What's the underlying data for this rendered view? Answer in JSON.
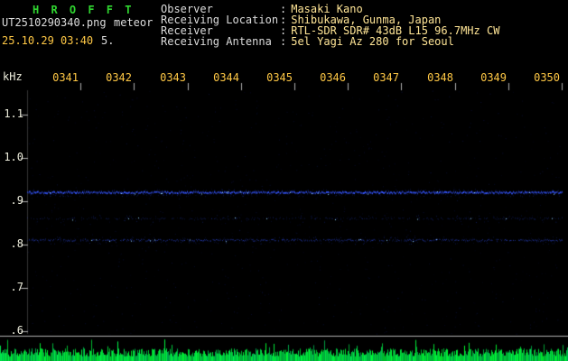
{
  "colors": {
    "title_green": "#30d530",
    "label_white": "#dcdcdc",
    "value_yellow": "#ffe596",
    "time_yellow": "#ffc845",
    "freq_label": "#eeeedd",
    "axis_gray": "#b0b0b0",
    "band_blue": "#3555ff",
    "speckle_cyan": "#9adcff",
    "noise_green": "#00d24b"
  },
  "header": {
    "title": "H R O F F T",
    "filename": "UT2510290340.png",
    "mode": "meteor",
    "datetime": "25.10.29 03:40",
    "counter": "5.",
    "separator": ":",
    "info": [
      {
        "label": "Observer",
        "value": "Masaki Kano"
      },
      {
        "label": "Receiving Location",
        "value": "Shibukawa, Gunma, Japan"
      },
      {
        "label": "Receiver",
        "value": "RTL-SDR SDR# 43dB L15 96.7MHz CW"
      },
      {
        "label": "Receiving Antenna",
        "value": "5el Yagi Az 280 for Seoul"
      }
    ]
  },
  "axes": {
    "freq_unit": "kHz",
    "freq_labels": [
      "1.1",
      "1.0",
      ".9",
      ".8",
      ".7",
      ".6"
    ],
    "freq_range_khz": [
      0.6,
      1.1
    ],
    "time_labels": [
      "0341",
      "0342",
      "0343",
      "0344",
      "0345",
      "0346",
      "0347",
      "0348",
      "0349",
      "0350"
    ]
  },
  "signal": {
    "bands": [
      {
        "name": "carrier-strong",
        "freq_khz": 0.92,
        "strength": 1.0
      },
      {
        "name": "carrier-faint",
        "freq_khz": 0.86,
        "strength": 0.3
      },
      {
        "name": "carrier-medium",
        "freq_khz": 0.81,
        "strength": 0.65
      }
    ]
  }
}
